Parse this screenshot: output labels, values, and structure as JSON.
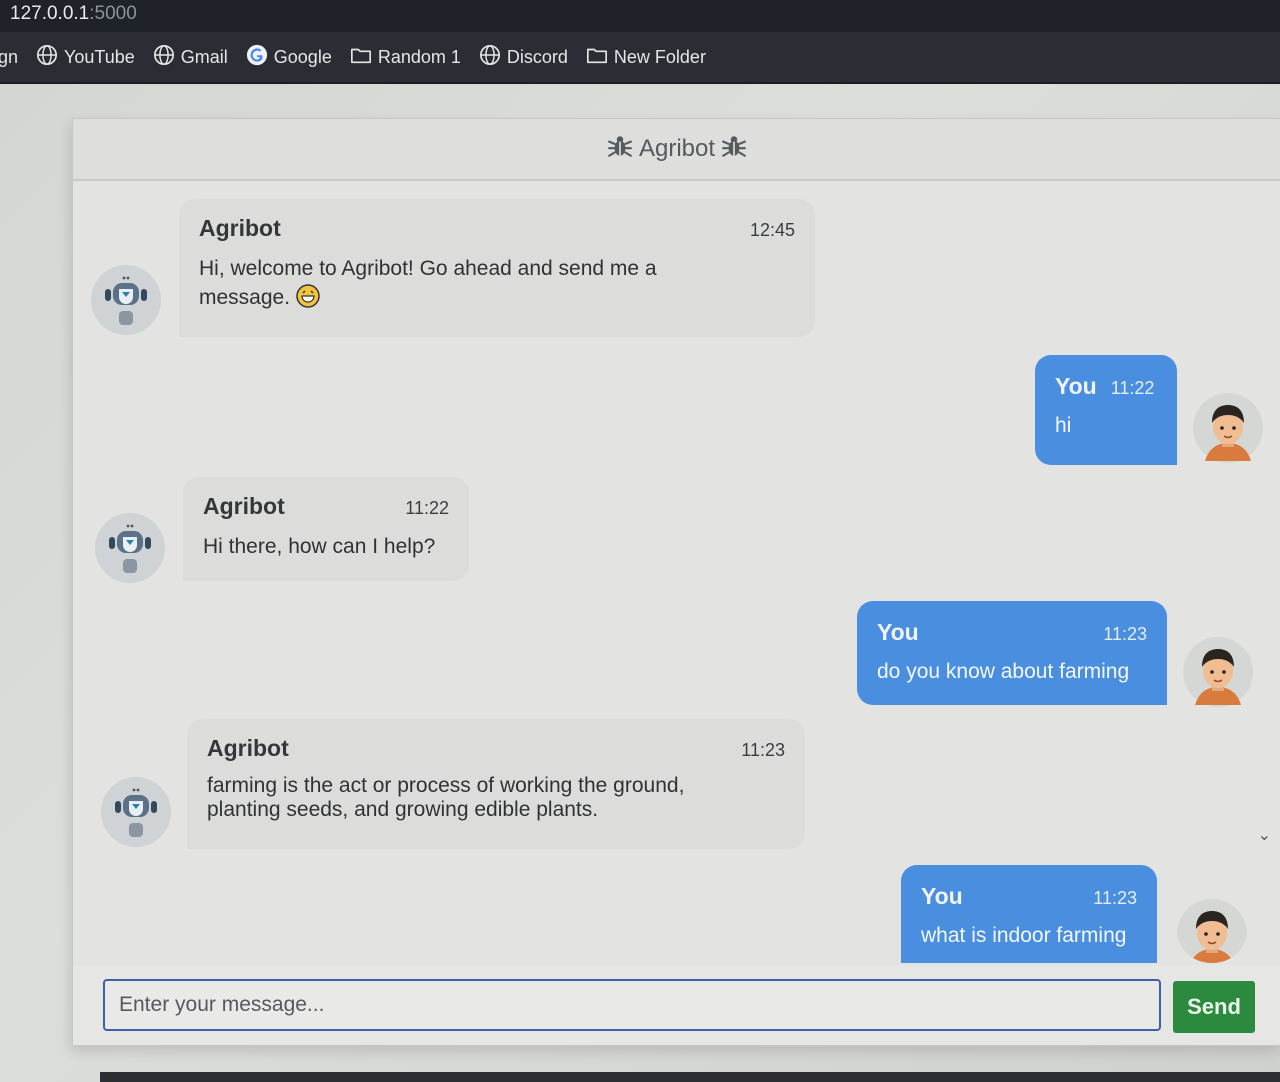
{
  "browser": {
    "url_host": "127.0.0.1",
    "url_port": ":5000",
    "bookmarks": [
      {
        "label": "ign",
        "icon": "none"
      },
      {
        "label": "YouTube",
        "icon": "globe-icon"
      },
      {
        "label": "Gmail",
        "icon": "globe-icon"
      },
      {
        "label": "Google",
        "icon": "google-icon"
      },
      {
        "label": "Random 1",
        "icon": "folder-icon"
      },
      {
        "label": "Discord",
        "icon": "globe-icon"
      },
      {
        "label": "New Folder",
        "icon": "folder-icon"
      }
    ]
  },
  "chat": {
    "title": "Agribot",
    "title_icon": "bug-icon",
    "messages": [
      {
        "sender": "Agribot",
        "role": "bot",
        "time": "12:45",
        "text": "Hi, welcome to Agribot! Go ahead and send me a message.",
        "emoji": "grinning-emoji"
      },
      {
        "sender": "You",
        "role": "user",
        "time": "11:22",
        "text": "hi"
      },
      {
        "sender": "Agribot",
        "role": "bot",
        "time": "11:22",
        "text": "Hi there, how can I help?"
      },
      {
        "sender": "You",
        "role": "user",
        "time": "11:23",
        "text": "do you know about farming"
      },
      {
        "sender": "Agribot",
        "role": "bot",
        "time": "11:23",
        "text": "farming is the act or process of working the ground, planting seeds, and growing edible plants."
      },
      {
        "sender": "You",
        "role": "user",
        "time": "11:23",
        "text": "what is indoor farming"
      }
    ],
    "input_placeholder": "Enter your message...",
    "send_label": "Send"
  },
  "colors": {
    "user_bubble": "#4a8ee0",
    "bot_bubble": "#dcdddb",
    "send_button": "#2b8a3e",
    "input_border": "#3f5fa8"
  }
}
